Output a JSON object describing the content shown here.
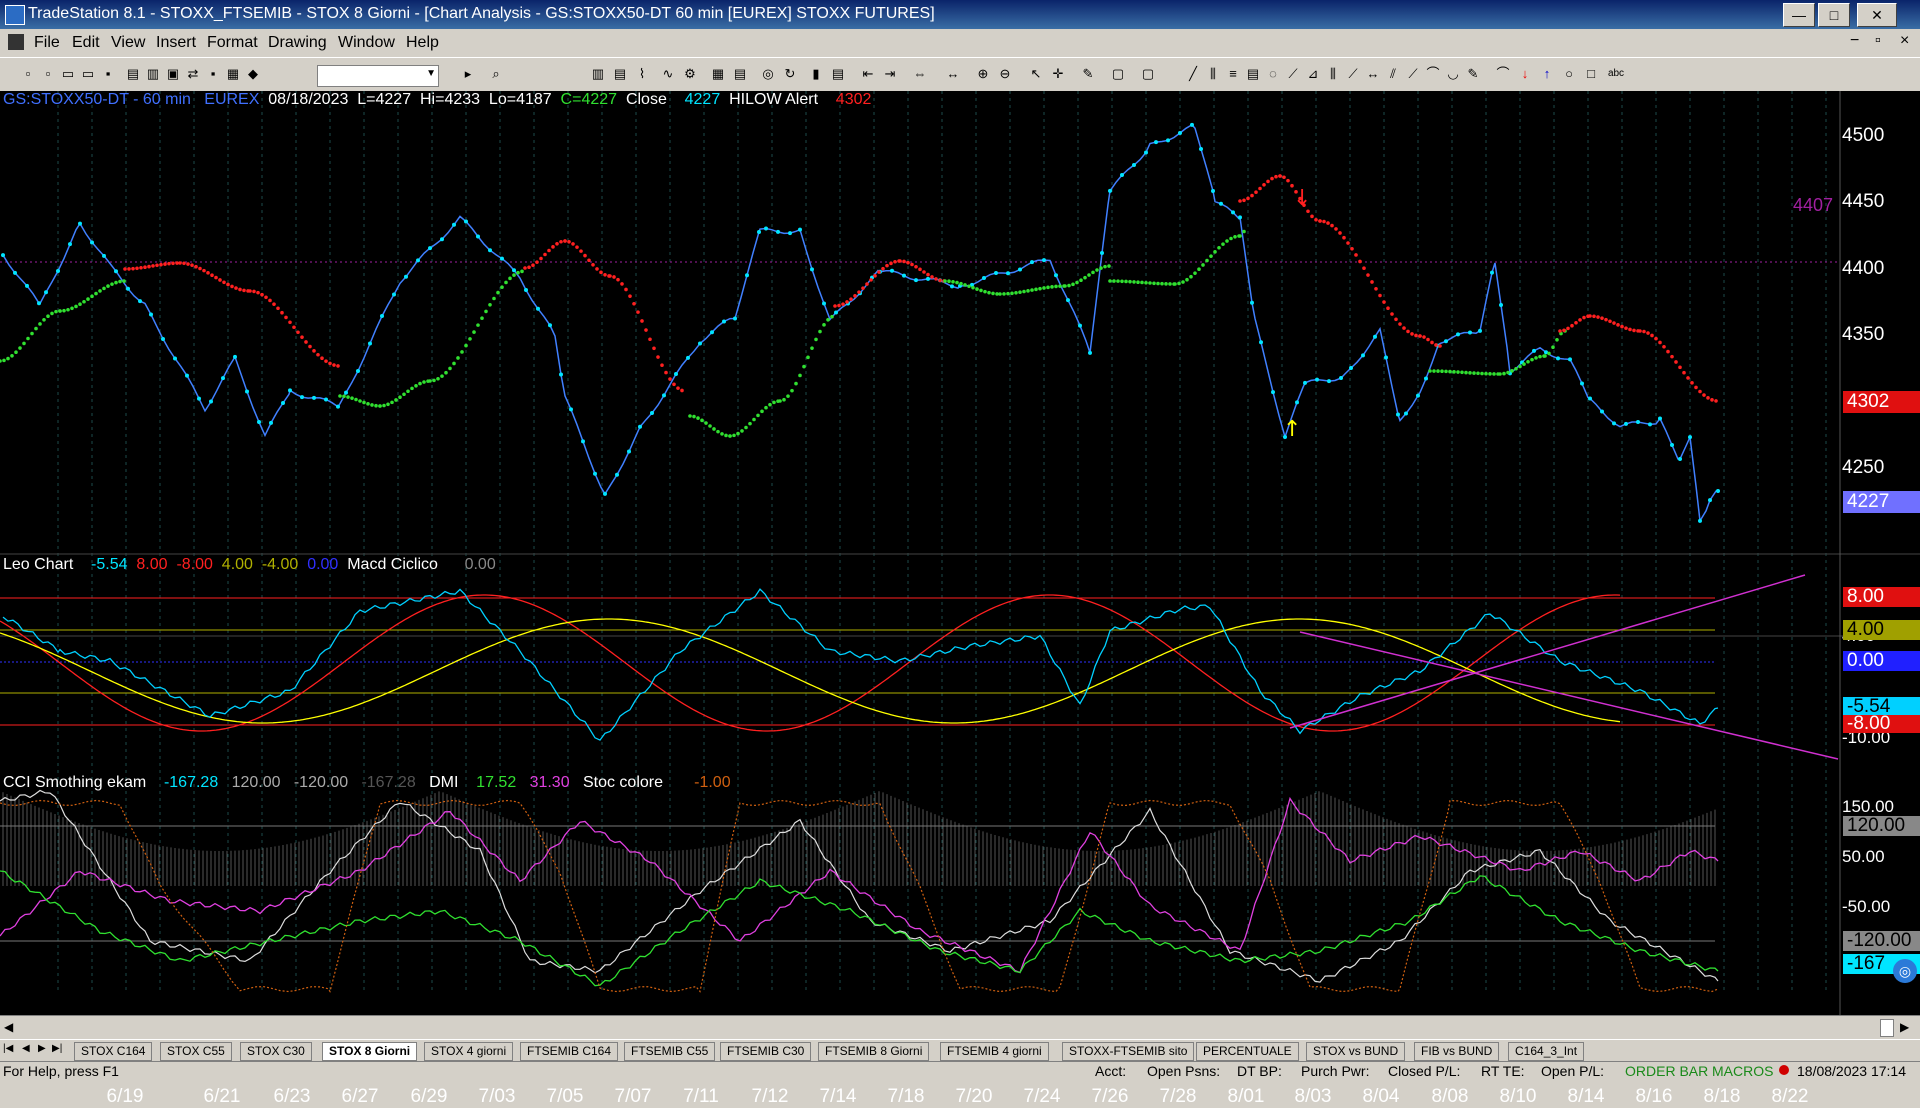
{
  "window": {
    "title": "TradeStation 8.1 - STOXX_FTSEMIB - STOX  8 Giorni - [Chart Analysis - GS:STOXX50-DT  60 min  [EUREX] STOXX FUTURES]",
    "minimize": "—",
    "maximize": "□",
    "close": "✕"
  },
  "menu": [
    "File",
    "Edit",
    "View",
    "Insert",
    "Format",
    "Drawing",
    "Window",
    "Help"
  ],
  "toolbar": {
    "combo_value": ""
  },
  "panel1": {
    "symbol": "GS:STOXX50-DT - 60 min",
    "exchange": "EUREX",
    "date": "08/18/2023",
    "last": "L=4227",
    "high": "Hi=4233",
    "low": "Lo=4187",
    "close": "C=4227",
    "close_label": "Close",
    "close_value": "4227",
    "indicator": "HILOW Alert",
    "indicator_value": "4302",
    "level_line": "4407",
    "axis": [
      "4500",
      "4450",
      "4400",
      "4350",
      "4300",
      "4250"
    ],
    "box_hilow": "4302",
    "box_close": "4227"
  },
  "panel2": {
    "name": "Leo Chart",
    "v1": "-5.54",
    "v2": "8.00",
    "v3": "-8.00",
    "v4": "4.00",
    "v5": "-4.00",
    "v6": "0.00",
    "indicator": "Macd Ciclico",
    "ind_value": "0.00",
    "axis_extra": [
      "4.00",
      "-10.00"
    ],
    "boxes": [
      "8.00",
      "4.00",
      "0.00",
      "-5.54",
      "-8.00"
    ]
  },
  "panel3": {
    "name": "CCI Smothing ekam",
    "v1": "-167.28",
    "v2": "120.00",
    "v3": "-120.00",
    "v4": "-167.28",
    "dmi": "DMI",
    "dmi1": "17.52",
    "dmi2": "31.30",
    "stoc": "Stoc colore",
    "stoc_value": "-1.00",
    "axis": [
      "150.00",
      "50.00",
      "-50.00"
    ],
    "boxes": [
      "120.00",
      "-120.00",
      "-167"
    ]
  },
  "xaxis": [
    "6/19",
    "6/21",
    "6/23",
    "6/27",
    "6/29",
    "7/03",
    "7/05",
    "7/07",
    "7/11",
    "7/12",
    "7/14",
    "7/18",
    "7/20",
    "7/24",
    "7/26",
    "7/28",
    "8/01",
    "8/03",
    "8/04",
    "8/08",
    "8/10",
    "8/14",
    "8/16",
    "8/18",
    "8/22"
  ],
  "tabs": [
    "STOX C164",
    "STOX C55",
    "STOX  C30",
    "STOX  8 Giorni",
    "STOX 4 giorni",
    "FTSEMIB C164",
    "FTSEMIB C55",
    "FTSEMIB C30",
    "FTSEMIB  8 Giorni",
    "FTSEMIB  4 giorni",
    "STOXX-FTSEMIB sito",
    "PERCENTUALE",
    "STOX vs BUND",
    "FIB vs BUND",
    "C164_3_Int"
  ],
  "status": {
    "help": "For Help, press F1",
    "acct": "Acct:",
    "psns": "Open Psns:",
    "dtbp": "DT BP:",
    "purch": "Purch Pwr:",
    "closed": "Closed P/L:",
    "rtte": "RT TE:",
    "openpl": "Open P/L:",
    "orderbar": "ORDER BAR",
    "macros": "MACROS",
    "datetime": "18/08/2023 17:14"
  },
  "colors": {
    "cyan": "#00e5ff",
    "red": "#ff2020",
    "green": "#30e030",
    "yellow": "#ffff00",
    "magenta": "#d030d0"
  }
}
